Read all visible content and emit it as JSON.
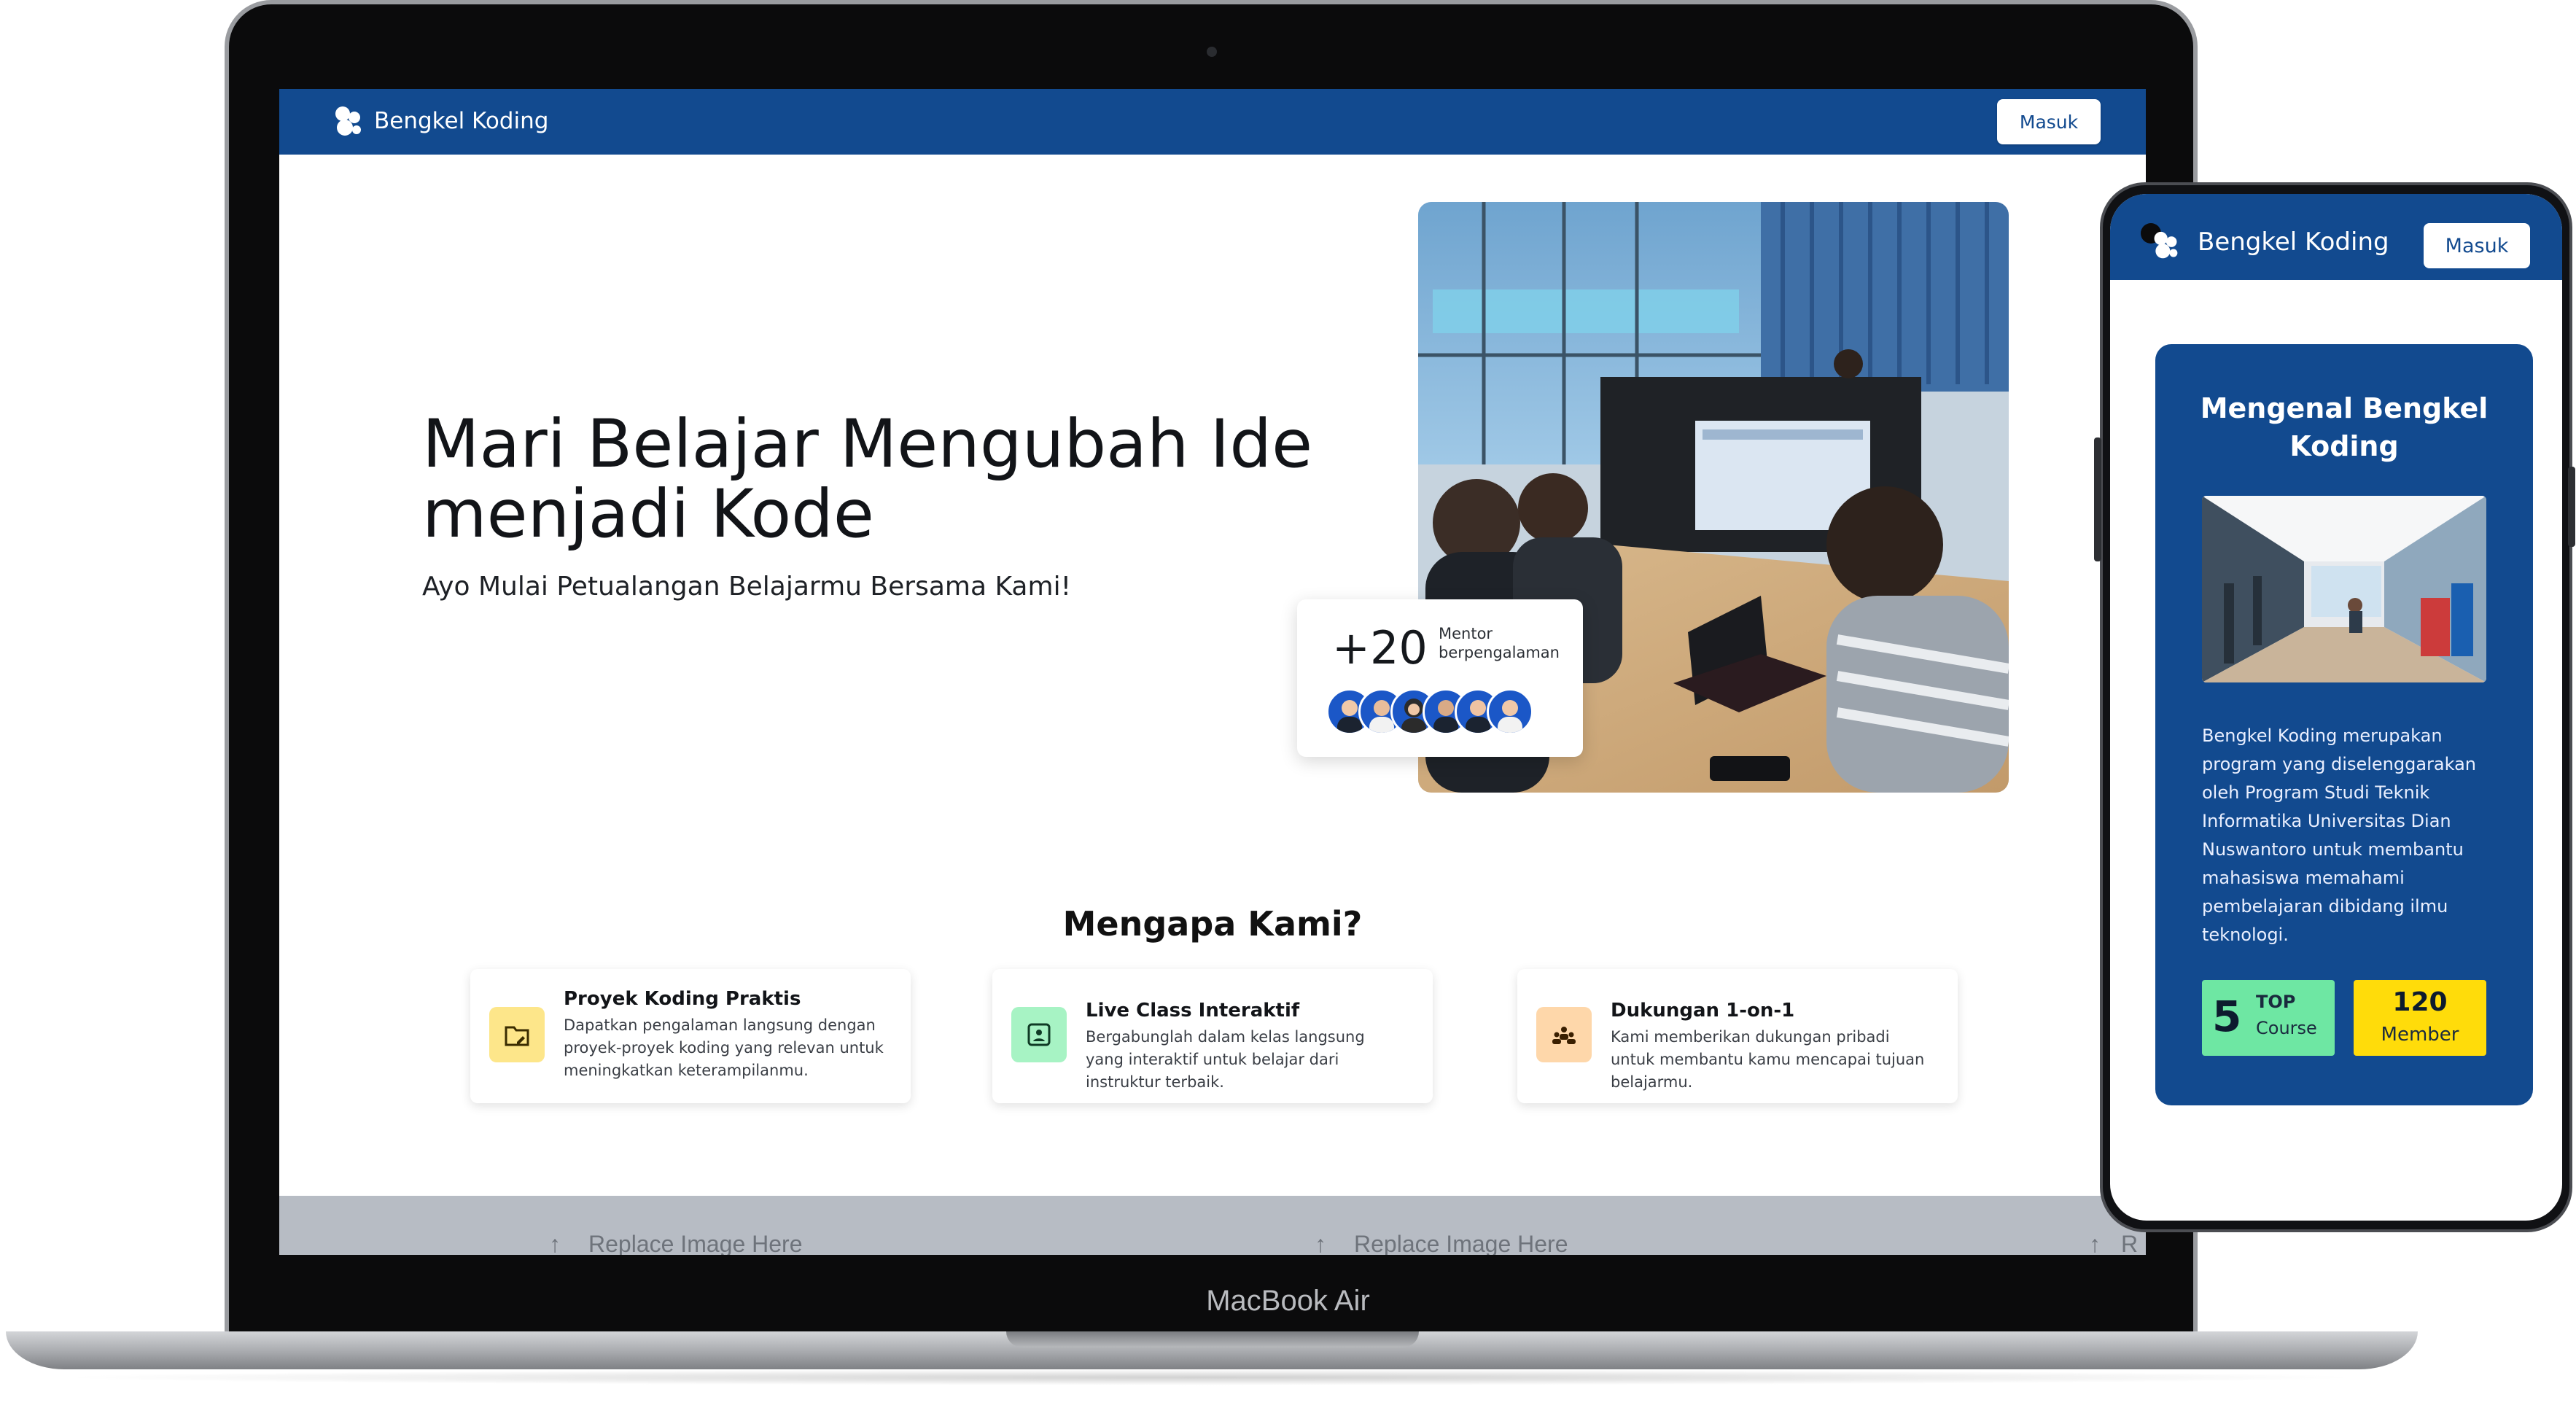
{
  "laptop": {
    "model_label": "MacBook Air",
    "nav": {
      "brand": "Bengkel Koding",
      "login_label": "Masuk"
    },
    "hero": {
      "title": "Mari Belajar Mengubah Ide menjadi Kode",
      "subtitle": "Ayo Mulai Petualangan Belajarmu Bersama Kami!",
      "mentor_count": "+20",
      "mentor_label": "Mentor berpengalaman",
      "mentor_avatars": 6
    },
    "why": {
      "title": "Mengapa Kami?",
      "features": [
        {
          "title": "Proyek Koding Praktis",
          "desc": "Dapatkan pengalaman langsung dengan proyek-proyek koding yang relevan untuk meningkatkan keterampilanmu.",
          "icon": "folder-edit-icon",
          "icon_bg": "#fde68a"
        },
        {
          "title": "Live Class Interaktif",
          "desc": "Bergabunglah dalam kelas langsung yang interaktif untuk belajar dari instruktur terbaik.",
          "icon": "video-class-icon",
          "icon_bg": "#a7f3c4"
        },
        {
          "title": "Dukungan 1-on-1",
          "desc": "Kami memberikan dukungan pribadi untuk membantu kamu mencapai tujuan belajarmu.",
          "icon": "people-support-icon",
          "icon_bg": "#fed7aa"
        }
      ]
    },
    "placeholders": [
      "Replace Image Here",
      "Replace Image Here",
      "R"
    ]
  },
  "phone": {
    "nav": {
      "brand": "Bengkel Koding",
      "login_label": "Masuk"
    },
    "card": {
      "title": "Mengenal Bengkel Koding",
      "description": "Bengkel Koding merupakan program yang diselenggarakan oleh Program Studi Teknik Informatika Universitas Dian Nuswantoro untuk membantu mahasiswa memahami pembelajaran dibidang ilmu teknologi.",
      "stats": [
        {
          "value": "5",
          "top": "TOP",
          "label": "Course",
          "color": "#6ee7a3"
        },
        {
          "value": "120",
          "label": "Member",
          "color": "#ffdc0a"
        }
      ]
    }
  },
  "colors": {
    "brand_blue": "#124a8f"
  }
}
